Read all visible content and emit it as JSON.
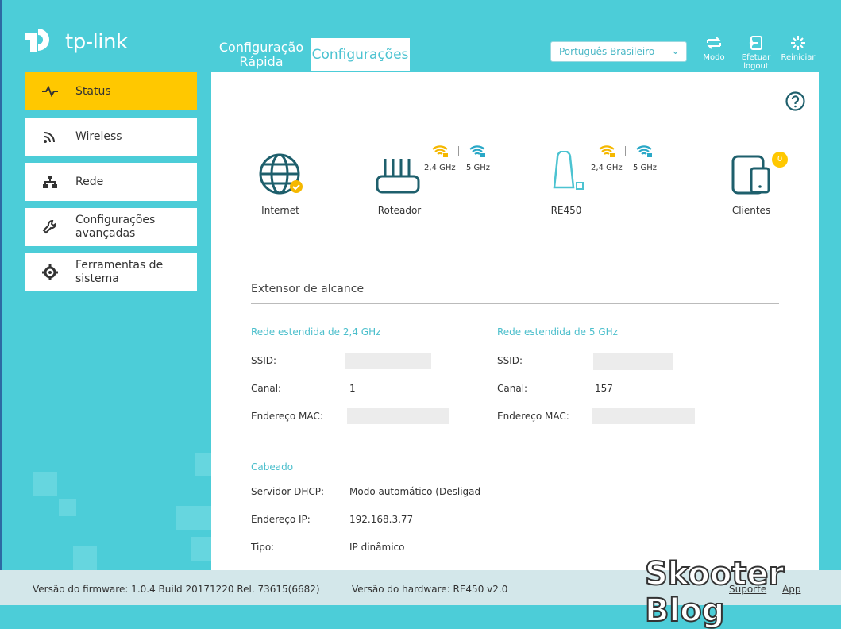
{
  "brand": {
    "logo_text": "tp-link"
  },
  "tabs": [
    {
      "label": "Configuração Rápida",
      "line1": "Configuração",
      "line2": "Rápida"
    },
    {
      "label": "Configurações"
    }
  ],
  "language": {
    "selected": "Português Brasileiro"
  },
  "top_buttons": [
    {
      "label": "Modo",
      "icon": "mode-icon"
    },
    {
      "label_line1": "Efetuar",
      "label_line2": "logout",
      "icon": "logout-icon"
    },
    {
      "label": "Reiniciar",
      "icon": "reboot-icon"
    }
  ],
  "sidebar": {
    "items": [
      {
        "label": "Status",
        "icon": "status-icon",
        "active": true
      },
      {
        "label": "Wireless",
        "icon": "wireless-icon"
      },
      {
        "label": "Rede",
        "icon": "network-icon"
      },
      {
        "label_line1": "Configurações",
        "label_line2": "avançadas",
        "icon": "wrench-icon"
      },
      {
        "label_line1": "Ferramentas de",
        "label_line2": "sistema",
        "icon": "gear-icon"
      }
    ]
  },
  "topology": {
    "internet": "Internet",
    "router": "Roteador",
    "router_bands": [
      "2,4 GHz",
      "5 GHz"
    ],
    "extender": "RE450",
    "extender_bands": [
      "2,4 GHz",
      "5 GHz"
    ],
    "clients": "Clientes",
    "clients_count": "0"
  },
  "section": {
    "title": "Extensor de alcance",
    "net24": {
      "title": "Rede estendida de 2,4 GHz",
      "ssid_label": "SSID:",
      "channel_label": "Canal:",
      "channel": "1",
      "mac_label": "Endereço MAC:"
    },
    "net5": {
      "title": "Rede estendida de 5 GHz",
      "ssid_label": "SSID:",
      "channel_label": "Canal:",
      "channel": "157",
      "mac_label": "Endereço MAC:"
    },
    "wired": {
      "title": "Cabeado",
      "dhcp_label": "Servidor DHCP:",
      "dhcp": "Modo automático (Desligad",
      "ip_label": "Endereço IP:",
      "ip": "192.168.3.77",
      "type_label": "Tipo:",
      "type": "IP dinâmico"
    }
  },
  "footer": {
    "firmware": "Versão do firmware: 1.0.4 Build 20171220 Rel. 73615(6682)",
    "hardware": "Versão do hardware: RE450 v2.0",
    "support": "Suporte",
    "app": "App"
  },
  "watermark": "Skooter Blog",
  "colors": {
    "accent": "#4cc3d1",
    "background": "#4ccdd8",
    "active": "#ffc800",
    "icon": "#1e5f6c"
  }
}
